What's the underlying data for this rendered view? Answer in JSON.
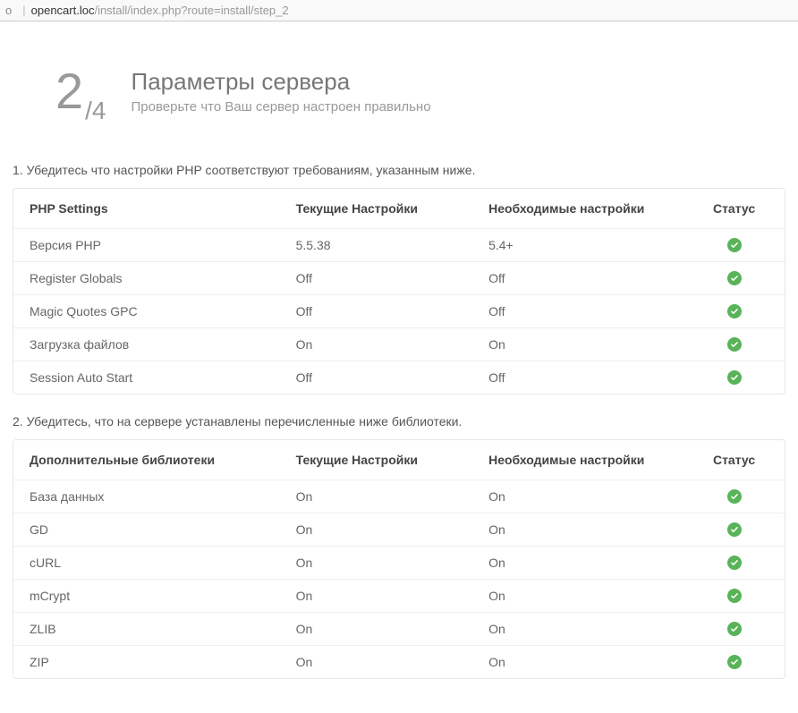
{
  "address_bar": {
    "prefix": "o",
    "host": "opencart.loc",
    "path": "/install/index.php?route=install/step_2"
  },
  "header": {
    "step_current": "2",
    "step_total": "/4",
    "title": "Параметры сервера",
    "subtitle": "Проверьте что Ваш сервер настроен правильно"
  },
  "section1": {
    "intro": "1. Убедитесь что настройки PHP соответствуют требованиям, указанным ниже.",
    "columns": {
      "name": "PHP Settings",
      "current": "Текущие Настройки",
      "required": "Необходимые настройки",
      "status": "Статус"
    },
    "rows": [
      {
        "name": "Версия PHP",
        "current": "5.5.38",
        "required": "5.4+",
        "status": "ok"
      },
      {
        "name": "Register Globals",
        "current": "Off",
        "required": "Off",
        "status": "ok"
      },
      {
        "name": "Magic Quotes GPC",
        "current": "Off",
        "required": "Off",
        "status": "ok"
      },
      {
        "name": "Загрузка файлов",
        "current": "On",
        "required": "On",
        "status": "ok"
      },
      {
        "name": "Session Auto Start",
        "current": "Off",
        "required": "Off",
        "status": "ok"
      }
    ]
  },
  "section2": {
    "intro": "2. Убедитесь, что на сервере устанавлены перечисленные ниже библиотеки.",
    "columns": {
      "name": "Дополнительные библиотеки",
      "current": "Текущие Настройки",
      "required": "Необходимые настройки",
      "status": "Статус"
    },
    "rows": [
      {
        "name": "База данных",
        "current": "On",
        "required": "On",
        "status": "ok"
      },
      {
        "name": "GD",
        "current": "On",
        "required": "On",
        "status": "ok"
      },
      {
        "name": "cURL",
        "current": "On",
        "required": "On",
        "status": "ok"
      },
      {
        "name": "mCrypt",
        "current": "On",
        "required": "On",
        "status": "ok"
      },
      {
        "name": "ZLIB",
        "current": "On",
        "required": "On",
        "status": "ok"
      },
      {
        "name": "ZIP",
        "current": "On",
        "required": "On",
        "status": "ok"
      }
    ]
  }
}
